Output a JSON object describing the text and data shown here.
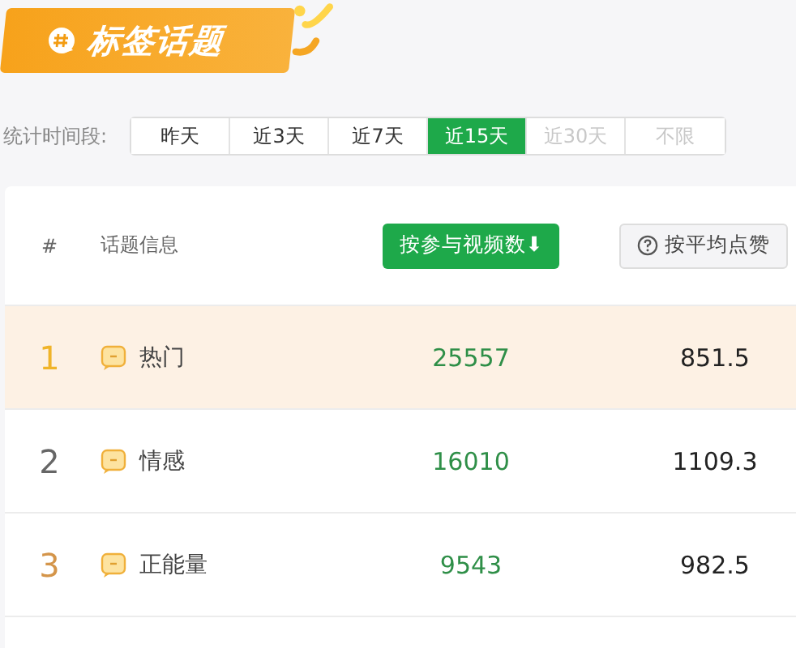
{
  "banner": {
    "title": "标签话题"
  },
  "filter": {
    "label": "统计时间段:",
    "options": [
      {
        "label": "昨天",
        "selected": false,
        "disabled": false
      },
      {
        "label": "近3天",
        "selected": false,
        "disabled": false
      },
      {
        "label": "近7天",
        "selected": false,
        "disabled": false
      },
      {
        "label": "近15天",
        "selected": true,
        "disabled": false
      },
      {
        "label": "近30天",
        "selected": false,
        "disabled": true
      },
      {
        "label": "不限",
        "selected": false,
        "disabled": true
      }
    ]
  },
  "table": {
    "columns": [
      {
        "label": "#",
        "kind": "text"
      },
      {
        "label": "话题信息",
        "kind": "text"
      },
      {
        "label": "按参与视频数⬇",
        "kind": "sort",
        "selected": true
      },
      {
        "label": "按平均点赞",
        "kind": "sort",
        "selected": false
      }
    ],
    "rows": [
      {
        "rank": "1",
        "color": "#f0b429",
        "topic": "热门",
        "videos": "25557",
        "likes": "851.5",
        "selected": true
      },
      {
        "rank": "2",
        "color": "#666666",
        "topic": "情感",
        "videos": "16010",
        "likes": "1109.3",
        "selected": false
      },
      {
        "rank": "3",
        "color": "#d4954a",
        "topic": "正能量",
        "videos": "9543",
        "likes": "982.5",
        "selected": false
      }
    ]
  }
}
